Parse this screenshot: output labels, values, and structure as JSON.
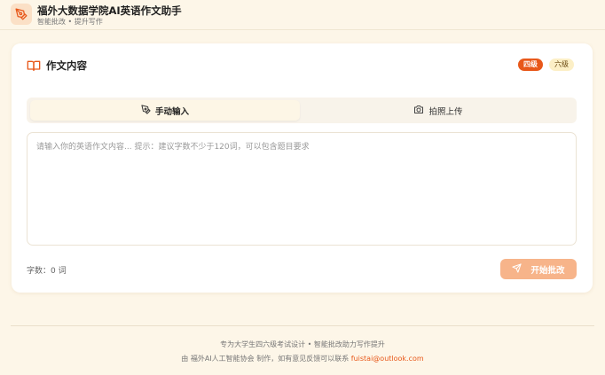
{
  "header": {
    "title": "福外大数据学院AI英语作文助手",
    "subtitle": "智能批改 • 提升写作"
  },
  "card": {
    "title": "作文内容",
    "badges": [
      "四级",
      "六级"
    ]
  },
  "tabs": [
    {
      "label": "手动输入",
      "icon": "pencil-icon",
      "active": true
    },
    {
      "label": "拍照上传",
      "icon": "camera-icon",
      "active": false
    }
  ],
  "essay": {
    "value": "",
    "placeholder": "请输入你的英语作文内容... 提示：建议字数不少于120词，可以包含题目要求"
  },
  "word_count": "字数：0 词",
  "submit_label": "开始批改",
  "footer": {
    "line1": "专为大学生四六级考试设计 • 智能批改助力写作提升",
    "line2_prefix": "由 福外AI人工智能协会 制作，如有意见反馈可以联系 ",
    "contact_email": "fuistai@outlook.com"
  },
  "colors": {
    "accent": "#e8581a",
    "button_disabled": "#f7b48a",
    "background": "#fdf6e8"
  }
}
